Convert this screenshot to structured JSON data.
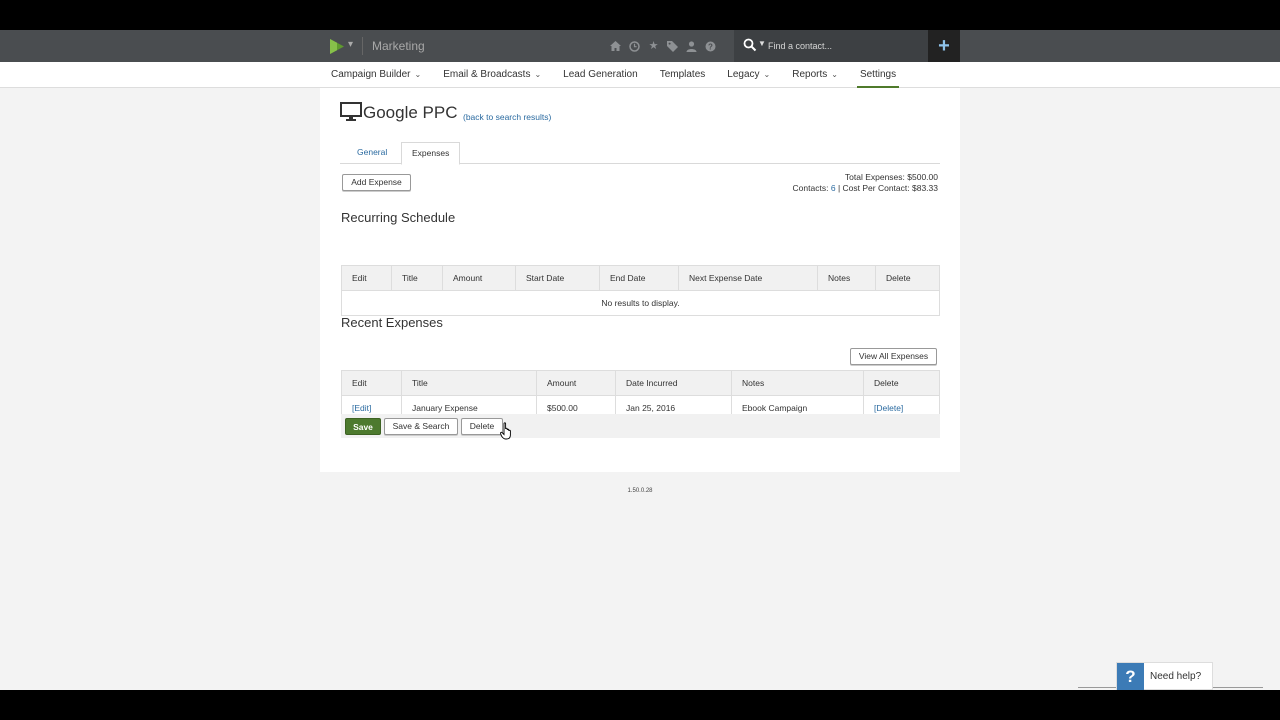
{
  "topbar": {
    "app_name": "Marketing",
    "icons": [
      "home-icon",
      "clock-icon",
      "star-icon",
      "tag-icon",
      "person-icon",
      "help-circle-icon"
    ],
    "search": {
      "placeholder": "Find a contact..."
    },
    "add_label": "+"
  },
  "nav": {
    "items": [
      {
        "label": "Campaign Builder",
        "dropdown": true
      },
      {
        "label": "Email & Broadcasts",
        "dropdown": true
      },
      {
        "label": "Lead Generation",
        "dropdown": false
      },
      {
        "label": "Templates",
        "dropdown": false
      },
      {
        "label": "Legacy",
        "dropdown": true
      },
      {
        "label": "Reports",
        "dropdown": true
      },
      {
        "label": "Settings",
        "dropdown": false,
        "active": true
      }
    ]
  },
  "page": {
    "title": "Google PPC",
    "back_link": "(back to search results)",
    "tabs": [
      {
        "label": "General",
        "active": false
      },
      {
        "label": "Expenses",
        "active": true
      }
    ],
    "add_expense_label": "Add Expense",
    "totals": {
      "total_label": "Total Expenses:",
      "total_value": "$500.00",
      "contacts_label": "Contacts:",
      "contacts_value": "6",
      "separator": "|",
      "cpc_label": "Cost Per Contact:",
      "cpc_value": "$83.33"
    }
  },
  "recurring": {
    "title": "Recurring Schedule",
    "columns": [
      "Edit",
      "Title",
      "Amount",
      "Start Date",
      "End Date",
      "Next Expense Date",
      "Notes",
      "Delete"
    ],
    "empty_message": "No results to display."
  },
  "recent": {
    "title": "Recent Expenses",
    "view_all_label": "View All Expenses",
    "columns": [
      "Edit",
      "Title",
      "Amount",
      "Date Incurred",
      "Notes",
      "Delete"
    ],
    "rows": [
      {
        "edit": "[Edit]",
        "title": "January Expense",
        "amount": "$500.00",
        "date": "Jan 25, 2016",
        "notes": "Ebook Campaign",
        "delete": "[Delete]"
      }
    ]
  },
  "actions": {
    "save": "Save",
    "save_search": "Save & Search",
    "delete": "Delete"
  },
  "version": "1.50.0.28",
  "help": {
    "icon": "?",
    "label": "Need help?"
  },
  "colors": {
    "topbar": "#4a4d50",
    "accent_green": "#4d7a2e",
    "link_blue": "#2a6aa0",
    "help_blue": "#3c7bb6"
  }
}
